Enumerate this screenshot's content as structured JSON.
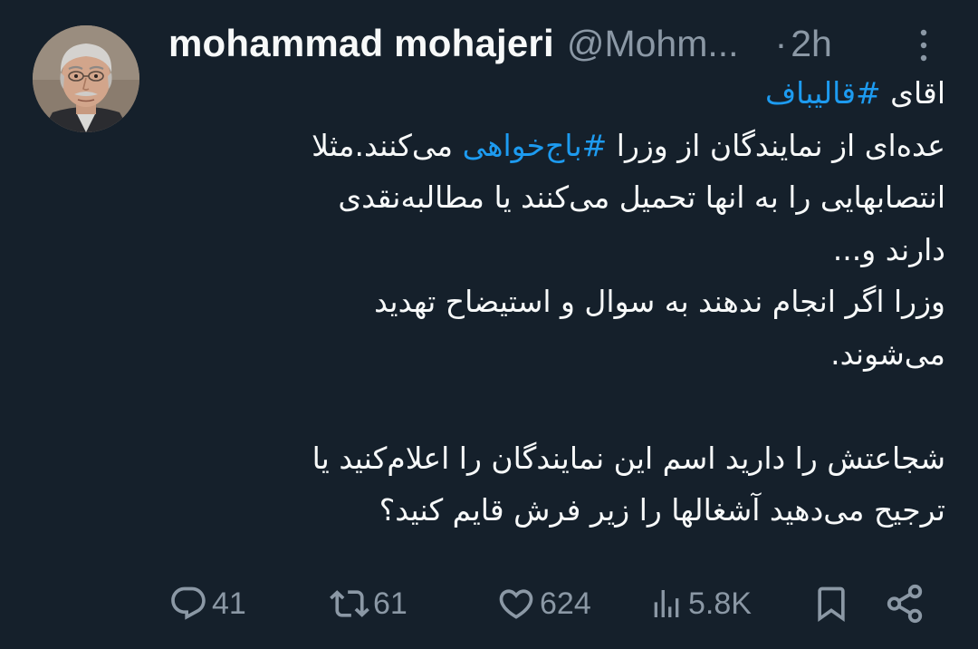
{
  "author": {
    "name": "mohammad mohajeri",
    "handle": "@Mohm...",
    "separator": "·",
    "time": "2h"
  },
  "tweet": {
    "lines": [
      {
        "parts": [
          {
            "text": "اقای ",
            "hashtag": false
          },
          {
            "text": "#قالیباف",
            "hashtag": true
          }
        ]
      },
      {
        "parts": [
          {
            "text": "عده‌ای از نمایندگان از وزرا ",
            "hashtag": false
          },
          {
            "text": "#باج‌خواهی",
            "hashtag": true
          },
          {
            "text": " می‌کنند.مثلا",
            "hashtag": false
          }
        ]
      },
      {
        "parts": [
          {
            "text": "انتصابهایی را به انها تحمیل می‌کنند یا مطالبه‌نقدی",
            "hashtag": false
          }
        ]
      },
      {
        "parts": [
          {
            "text": "دارند و...",
            "hashtag": false
          }
        ]
      },
      {
        "parts": [
          {
            "text": "وزرا اگر انجام ندهند به سوال و استیضاح تهدید",
            "hashtag": false
          }
        ]
      },
      {
        "parts": [
          {
            "text": "می‌شوند.",
            "hashtag": false
          }
        ]
      },
      {
        "parts": []
      },
      {
        "parts": [
          {
            "text": "شجاعتش را دارید اسم این نمایندگان  را اعلام‌کنید یا",
            "hashtag": false
          }
        ]
      },
      {
        "parts": [
          {
            "text": "ترجیح می‌دهید آشغالها را زیر فرش قایم کنید؟",
            "hashtag": false
          }
        ]
      }
    ]
  },
  "actions": {
    "replies": "41",
    "retweets": "61",
    "likes": "624",
    "views": "5.8K"
  },
  "icons": {
    "more": "more-vertical-icon",
    "reply": "reply-icon",
    "retweet": "retweet-icon",
    "like": "heart-icon",
    "views": "views-bar-chart-icon",
    "bookmark": "bookmark-icon",
    "share": "share-icon"
  },
  "colors": {
    "background": "#15202b",
    "text": "#f7f9f9",
    "secondary": "#8b98a5",
    "link": "#1d9bf0"
  }
}
